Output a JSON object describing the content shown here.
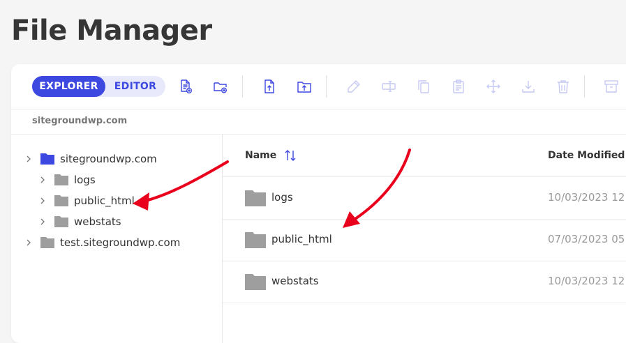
{
  "page": {
    "title": "File Manager"
  },
  "toolbar": {
    "modes": {
      "explorer": "EXPLORER",
      "editor": "EDITOR",
      "active": "EXPLORER"
    },
    "icons": [
      "new-file-icon",
      "new-folder-icon",
      "upload-file-icon",
      "upload-folder-icon",
      "rename-icon",
      "rename-field-icon",
      "copy-icon",
      "paste-icon",
      "move-icon",
      "download-icon",
      "delete-icon",
      "archive-icon"
    ]
  },
  "breadcrumb": {
    "path": "sitegroundwp.com"
  },
  "tree": [
    {
      "label": "sitegroundwp.com",
      "active": true
    },
    {
      "label": "logs"
    },
    {
      "label": "public_html"
    },
    {
      "label": "webstats"
    },
    {
      "label": "test.sitegroundwp.com"
    }
  ],
  "list": {
    "columns": {
      "name": "Name",
      "date": "Date Modified"
    },
    "rows": [
      {
        "name": "logs",
        "date": "10/03/2023 12:"
      },
      {
        "name": "public_html",
        "date": "07/03/2023 05:"
      },
      {
        "name": "webstats",
        "date": "10/03/2023 12:"
      }
    ]
  },
  "colors": {
    "accent": "#3d48e0",
    "annotation_arrow": "#e8001c",
    "folder": "#9e9e9e",
    "disabled_icon": "#c6c9f3"
  }
}
